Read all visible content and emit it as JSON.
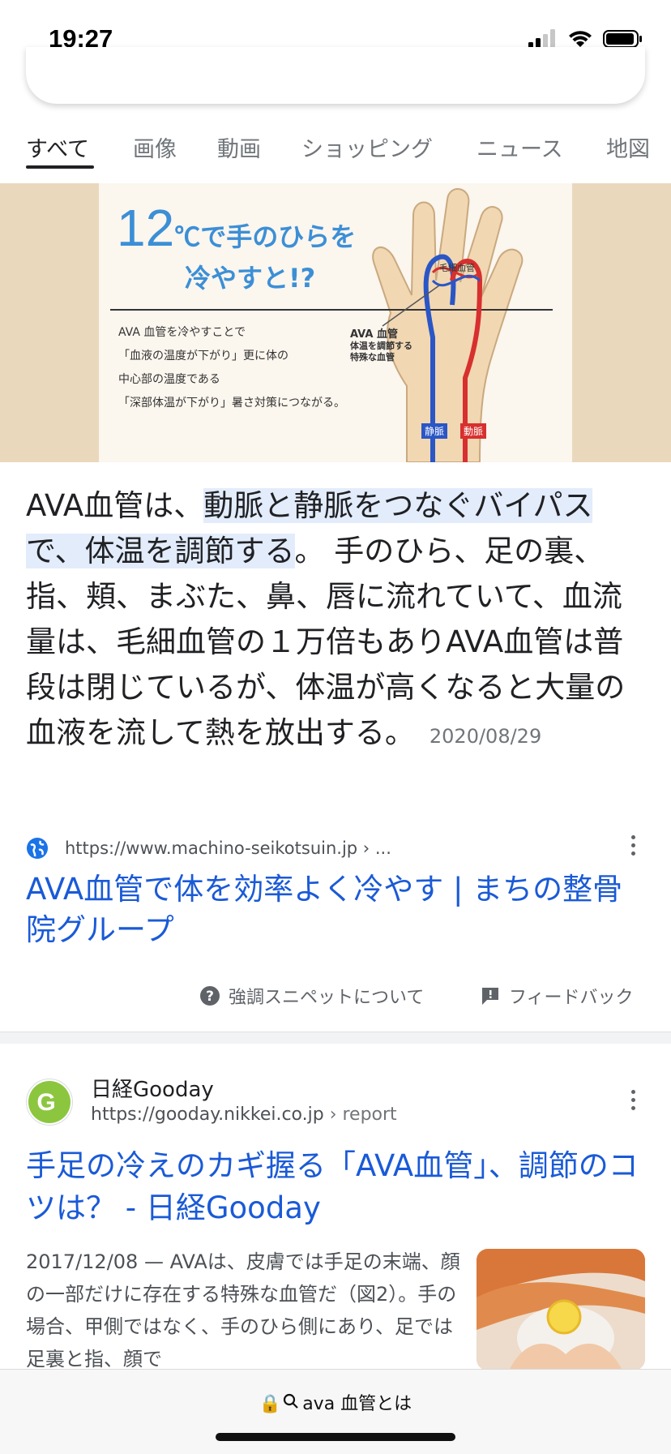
{
  "status_bar": {
    "time": "19:27"
  },
  "tabs": [
    {
      "label": "すべて",
      "active": true
    },
    {
      "label": "画像"
    },
    {
      "label": "動画"
    },
    {
      "label": "ショッピング"
    },
    {
      "label": "ニュース"
    },
    {
      "label": "地図"
    }
  ],
  "hero": {
    "headline_1": "12",
    "headline_2": "℃で手のひらを",
    "headline_3": "冷やすと!?",
    "line_1": "AVA 血管を冷やすことで",
    "line_2": "「血液の温度が下がり」更に体の",
    "line_3": "中心部の温度である",
    "line_4": "「深部体温が下がり」暑さ対策につながる。",
    "label_capillary": "毛細血管",
    "label_ava": "AVA 血管",
    "label_ava_sub1": "体温を調節する",
    "label_ava_sub2": "特殊な血管",
    "label_vein": "静脈",
    "label_artery": "動脈"
  },
  "snippet": {
    "prefix": "AVA血管は、",
    "highlight": "動脈と静脈をつなぐバイパスで、体温を調節する",
    "rest": "。 手のひら、足の裏、指、頬、まぶた、鼻、唇に流れていて、血流量は、毛細血管の１万倍もありAVA血管は普段は閉じているが、体温が高くなると大量の血液を流して熱を放出する。",
    "date": "2020/08/29"
  },
  "featured_result": {
    "url": "https://www.machino-seikotsuin.jp › ...",
    "title": "AVA血管で体を効率よく冷やす | まちの整骨院グループ"
  },
  "feedback": {
    "about": "強調スニペットについて",
    "feedback": "フィードバック"
  },
  "result2": {
    "site_name": "日経Gooday",
    "url": "https://gooday.nikkei.co.jp",
    "url_path": " › report",
    "title": "手足の冷えのカギ握る「AVA血管」、調節のコツは？ - 日経Gooday",
    "description": "2017/12/08 — AVAは、皮膚では手足の末端、顔の一部だけに存在する特殊な血管だ（図2）。手の場合、甲側ではなく、手のひら側にあり、足では足裏と指、顔で"
  },
  "bottom_bar": {
    "url_text": "ava 血管とは"
  }
}
